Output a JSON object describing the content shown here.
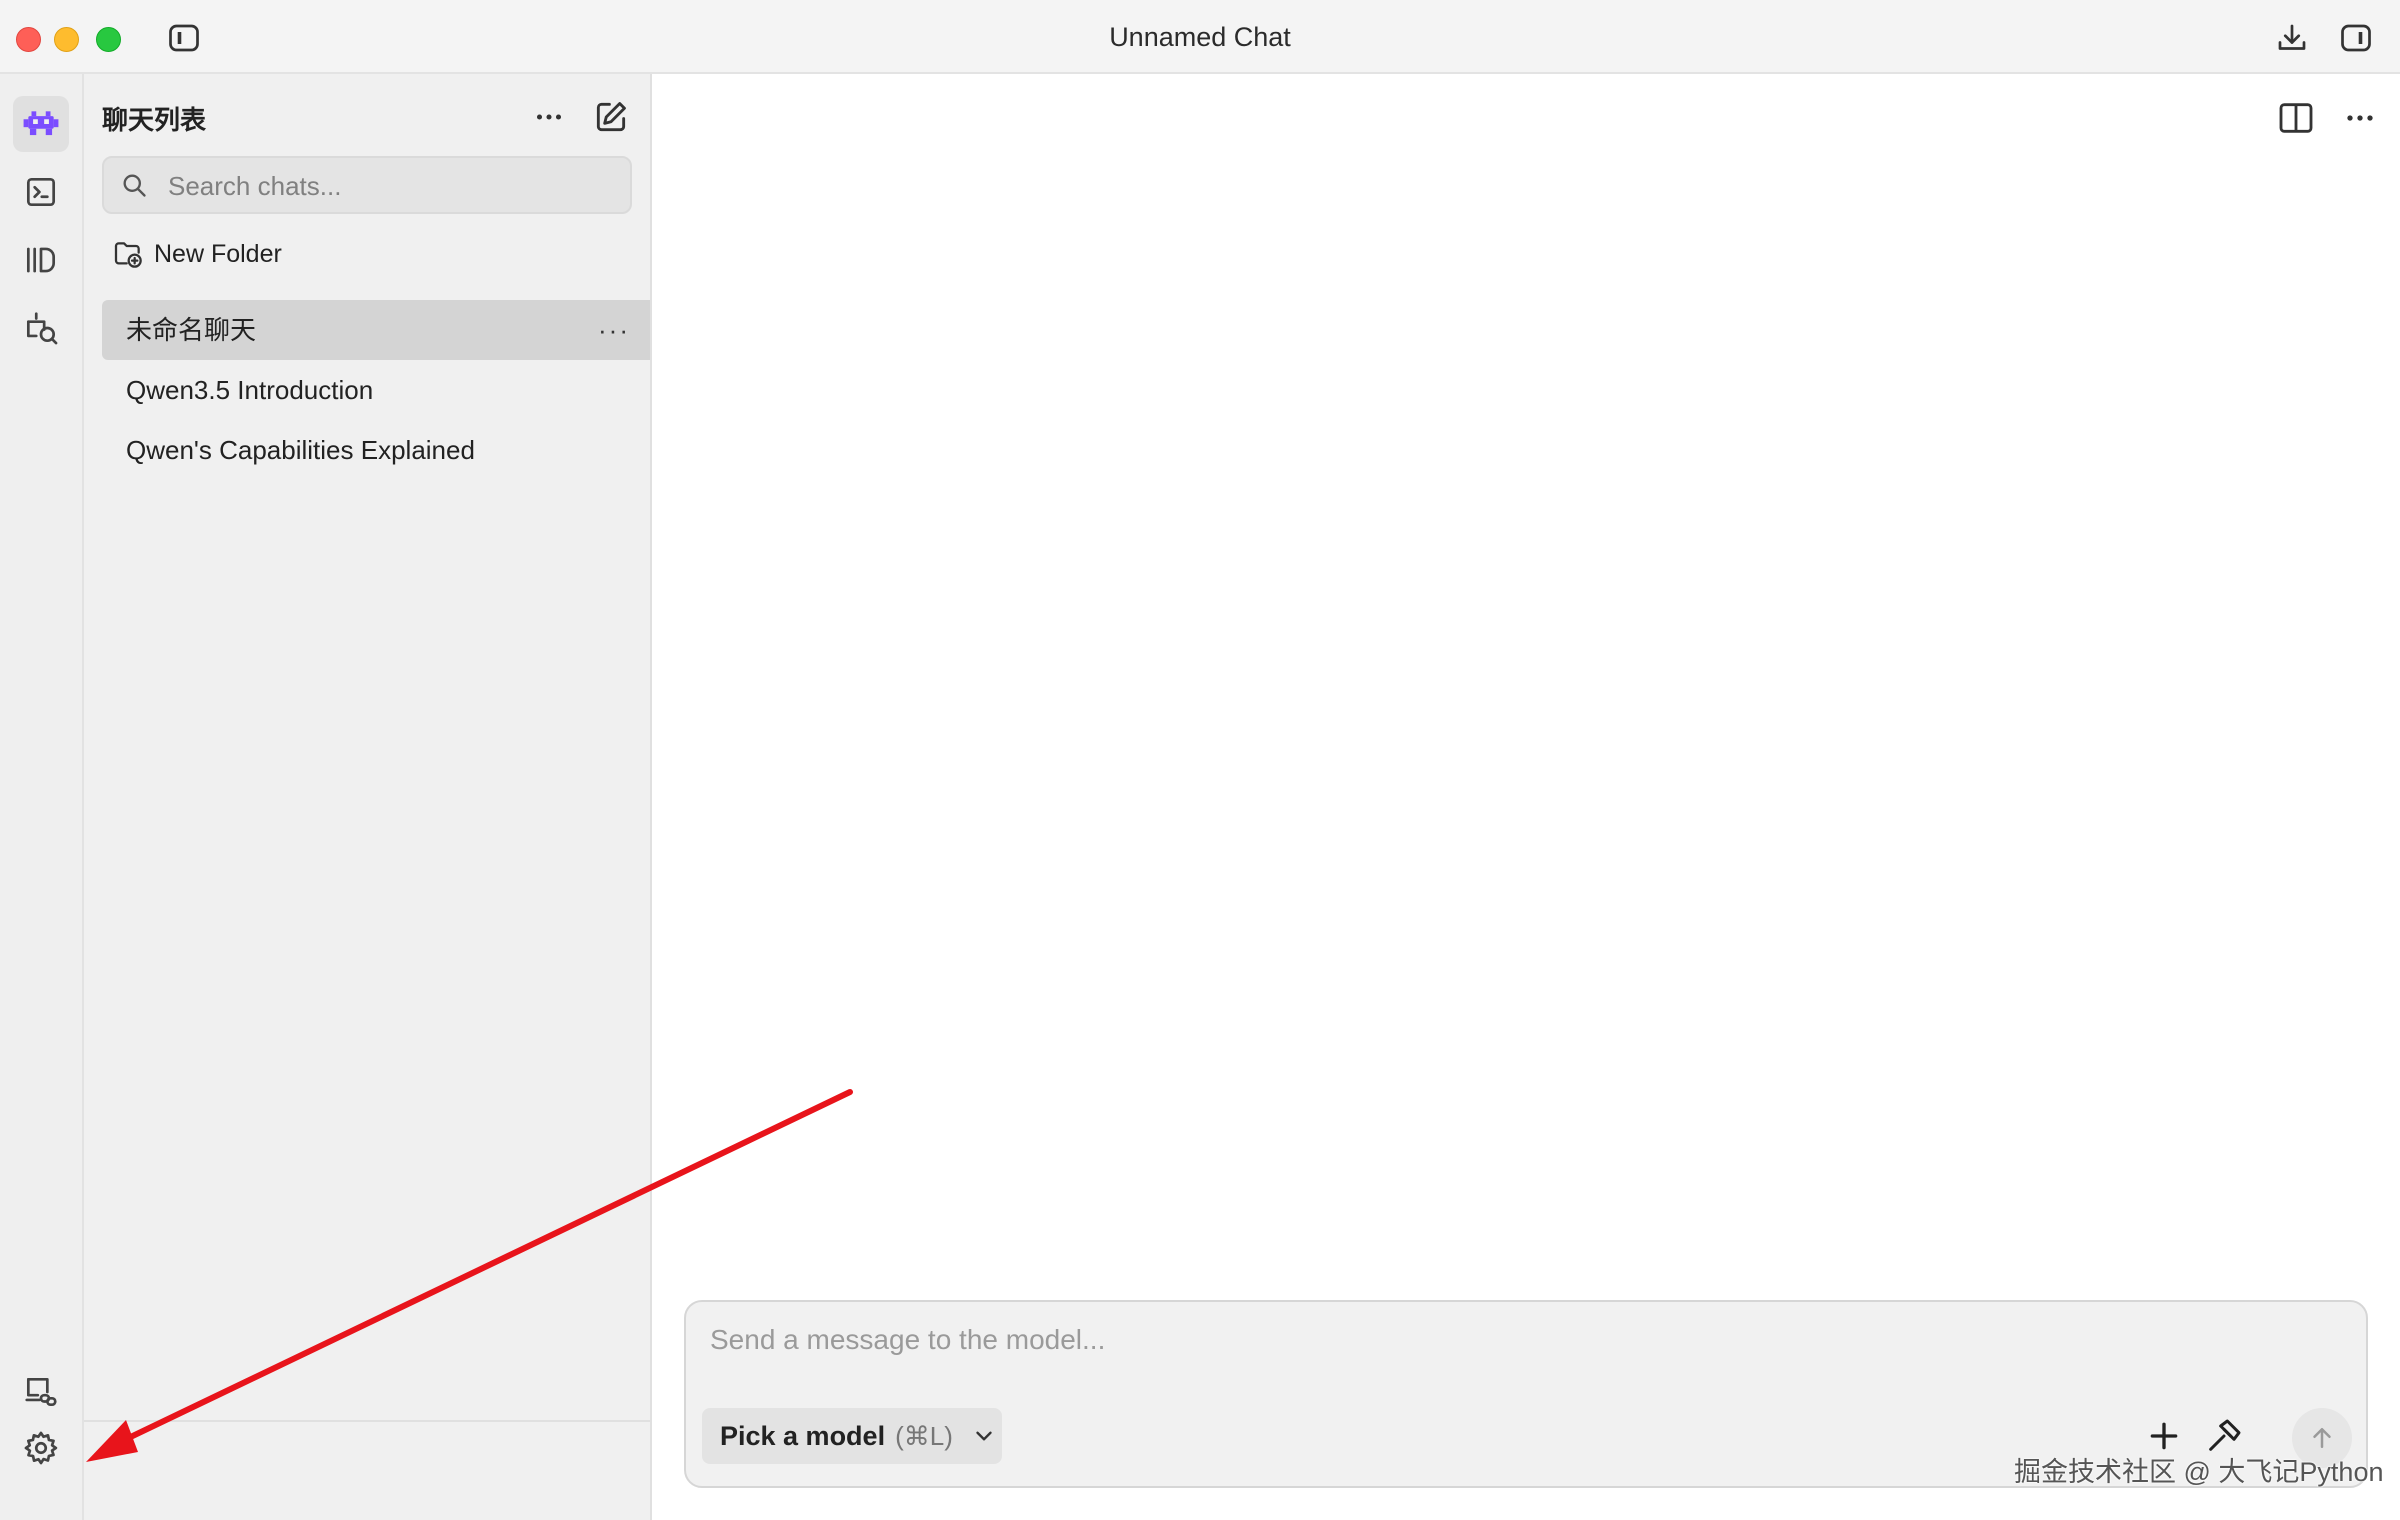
{
  "window": {
    "title": "Unnamed Chat",
    "icons": [
      "download-icon",
      "right-panel-icon",
      "left-panel-toggle-icon"
    ]
  },
  "rail": {
    "items": [
      {
        "name": "chat",
        "icon": "robot-icon",
        "active": true
      },
      {
        "name": "developer",
        "icon": "terminal-icon"
      },
      {
        "name": "models",
        "icon": "library-icon"
      },
      {
        "name": "discover",
        "icon": "search-models-icon"
      },
      {
        "name": "remote",
        "icon": "link-device-icon"
      },
      {
        "name": "settings",
        "icon": "gear-icon"
      }
    ],
    "accent_color": "#7b4dff"
  },
  "sidebar": {
    "title": "聊天列表",
    "search_placeholder": "Search chats...",
    "new_folder_label": "New Folder",
    "chats": [
      {
        "title": "未命名聊天",
        "selected": true
      },
      {
        "title": "Qwen3.5 Introduction"
      },
      {
        "title": "Qwen's Capabilities Explained"
      }
    ],
    "more_glyph": "···"
  },
  "composer": {
    "placeholder": "Send a message to the model...",
    "model_label": "Pick a model",
    "model_shortcut": "(⌘L)"
  },
  "annotation": {
    "arrow_color": "#e8141b",
    "points_to": "settings"
  },
  "watermark": "掘金技术社区 @ 大飞记Python"
}
